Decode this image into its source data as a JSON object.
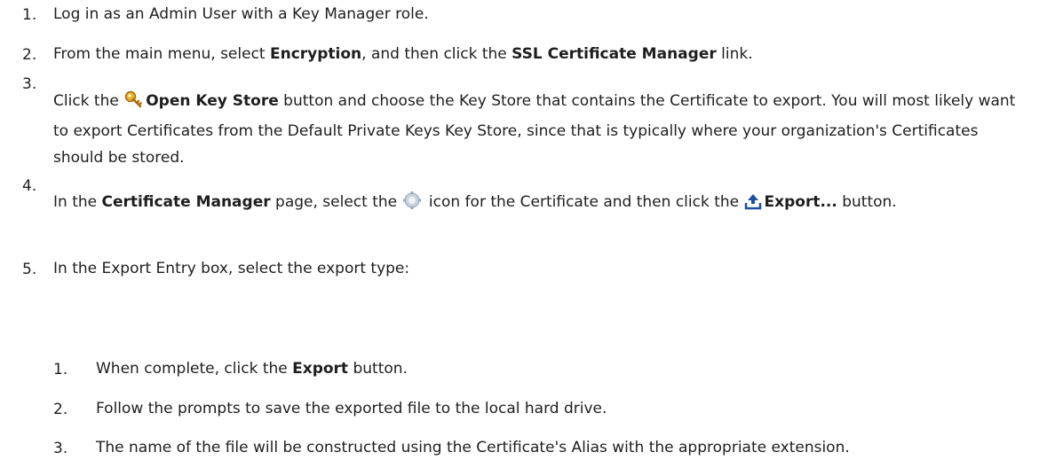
{
  "steps": [
    {
      "n": "1.",
      "t": "Log in as an Admin User with a Key Manager role."
    },
    {
      "n": "2.",
      "a": "From the main menu, select ",
      "b1": "Encryption",
      "c": ", and then click the ",
      "b2": "SSL Certificate Manager",
      "d": " link."
    },
    {
      "n": "3.",
      "a": "Click the ",
      "icon": "key-icon",
      "b1": "Open Key Store",
      "c": " button and choose the Key Store that contains the Certificate to export. You will most likely want to export Certificates from the Default Private Keys Key Store, since that is typically where your organization's Certificates should be stored."
    },
    {
      "n": "4.",
      "a": "In the ",
      "b1": "Certificate Manager",
      "c": " page, select the ",
      "icon1": "gear-icon",
      "d": " icon for the Certificate and then click the ",
      "icon2": "export-icon",
      "b2": "Export...",
      "e": " button."
    },
    {
      "n": "5.",
      "t": "In the Export Entry box, select the export type:"
    }
  ],
  "substeps": [
    {
      "n": "1.",
      "a": "When complete, click the ",
      "b1": "Export",
      "c": " button."
    },
    {
      "n": "2.",
      "t": "Follow the prompts to save the exported file to the local hard drive."
    },
    {
      "n": "3.",
      "t": "The name of the file will be constructed using the Certificate's Alias with the appropriate extension."
    }
  ]
}
